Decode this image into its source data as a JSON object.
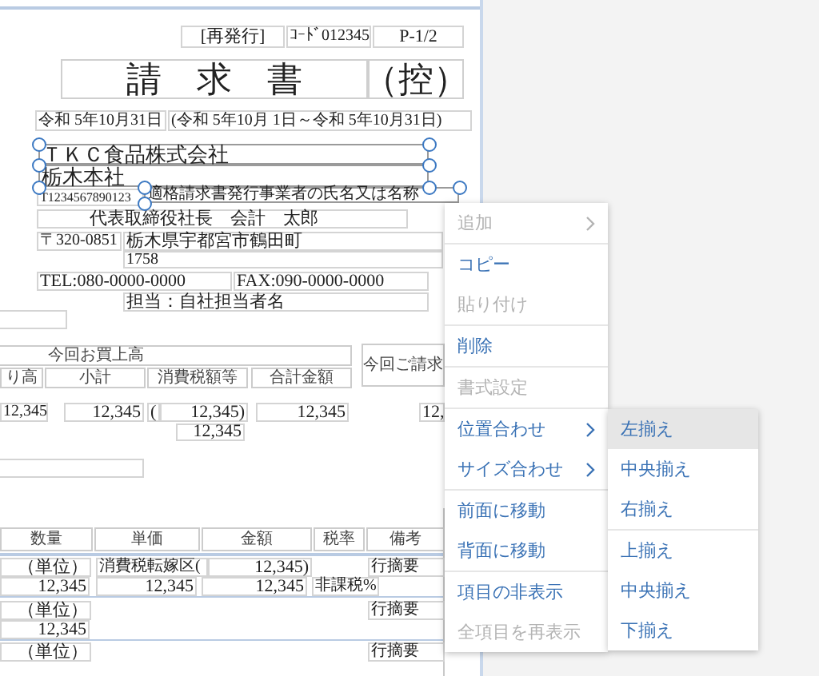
{
  "document": {
    "fields": [
      {
        "kind": "field",
        "text": "[再発行]",
        "selected": false
      },
      {
        "kind": "field",
        "text": "ｺｰﾄﾞ012345",
        "selected": false
      },
      {
        "kind": "field",
        "text": "P-1/2",
        "selected": false
      },
      {
        "kind": "title",
        "text": "請　求　書",
        "selected": false
      },
      {
        "kind": "title",
        "text": "（控）",
        "selected": false
      },
      {
        "kind": "field",
        "text": "令和 5年10月31日",
        "selected": false
      },
      {
        "kind": "field",
        "text": "(令和 5年10月 1日～令和 5年10月31日)",
        "selected": false
      },
      {
        "kind": "field",
        "text": "ＴＫＣ食品株式会社",
        "selected": true
      },
      {
        "kind": "field",
        "text": "栃木本社",
        "selected": true
      },
      {
        "kind": "field",
        "text": "T1234567890123",
        "selected": false
      },
      {
        "kind": "field",
        "text": "適格請求書発行事業者の氏名又は名称",
        "selected": true
      },
      {
        "kind": "field",
        "text": "代表取締役社長　会計　太郎",
        "selected": false
      },
      {
        "kind": "field",
        "text": "〒320-0851",
        "selected": false
      },
      {
        "kind": "field",
        "text": "栃木県宇都宮市鶴田町",
        "selected": false
      },
      {
        "kind": "field",
        "text": "1758",
        "selected": false
      },
      {
        "kind": "field",
        "text": "TEL:080-0000-0000",
        "selected": false
      },
      {
        "kind": "field",
        "text": "FAX:090-0000-0000",
        "selected": false
      },
      {
        "kind": "field",
        "text": "担当：自社担当者名",
        "selected": false
      },
      {
        "kind": "header",
        "text": "今回お買上高",
        "selected": false
      },
      {
        "kind": "header",
        "text": "今回ご請求",
        "selected": false
      },
      {
        "kind": "header",
        "text": "り高",
        "selected": false
      },
      {
        "kind": "header",
        "text": "小計",
        "selected": false
      },
      {
        "kind": "header",
        "text": "消費税額等",
        "selected": false
      },
      {
        "kind": "header",
        "text": "合計金額",
        "selected": false
      },
      {
        "kind": "field",
        "text": "12,345",
        "selected": false
      },
      {
        "kind": "field",
        "text": "12,345",
        "selected": false
      },
      {
        "kind": "field",
        "text": "(",
        "selected": false
      },
      {
        "kind": "field",
        "text": "12,345)",
        "selected": false
      },
      {
        "kind": "field",
        "text": "12,345",
        "selected": false
      },
      {
        "kind": "field",
        "text": "12,",
        "selected": false
      },
      {
        "kind": "field",
        "text": "12,345",
        "selected": false
      },
      {
        "kind": "header",
        "text": "数量",
        "selected": false
      },
      {
        "kind": "header",
        "text": "単価",
        "selected": false
      },
      {
        "kind": "header",
        "text": "金額",
        "selected": false
      },
      {
        "kind": "header",
        "text": "税率",
        "selected": false
      },
      {
        "kind": "header",
        "text": "備考",
        "selected": false
      },
      {
        "kind": "field",
        "text": "（単位）",
        "selected": false
      },
      {
        "kind": "field",
        "text": "消費税転嫁区(",
        "selected": false
      },
      {
        "kind": "field",
        "text": "12,345)",
        "selected": false
      },
      {
        "kind": "field",
        "text": "行摘要",
        "selected": false
      },
      {
        "kind": "field",
        "text": "12,345",
        "selected": false
      },
      {
        "kind": "field",
        "text": "12,345",
        "selected": false
      },
      {
        "kind": "field",
        "text": "12,345",
        "selected": false
      },
      {
        "kind": "field",
        "text": "非課税%",
        "selected": false
      },
      {
        "kind": "field",
        "text": "（単位）",
        "selected": false
      },
      {
        "kind": "field",
        "text": "行摘要",
        "selected": false
      },
      {
        "kind": "field",
        "text": "12,345",
        "selected": false
      },
      {
        "kind": "field",
        "text": "（単位）",
        "selected": false
      },
      {
        "kind": "field",
        "text": "行摘要",
        "selected": false
      }
    ]
  },
  "context_menu": {
    "groups": [
      [
        {
          "label": "追加",
          "disabled": true,
          "submenu": true
        }
      ],
      [
        {
          "label": "コピー",
          "disabled": false,
          "submenu": false
        },
        {
          "label": "貼り付け",
          "disabled": true,
          "submenu": false
        }
      ],
      [
        {
          "label": "削除",
          "disabled": false,
          "submenu": false
        }
      ],
      [
        {
          "label": "書式設定",
          "disabled": true,
          "submenu": false
        }
      ],
      [
        {
          "label": "位置合わせ",
          "disabled": false,
          "submenu": true
        },
        {
          "label": "サイズ合わせ",
          "disabled": false,
          "submenu": true
        }
      ],
      [
        {
          "label": "前面に移動",
          "disabled": false,
          "submenu": false
        },
        {
          "label": "背面に移動",
          "disabled": false,
          "submenu": false
        }
      ],
      [
        {
          "label": "項目の非表示",
          "disabled": false,
          "submenu": false
        },
        {
          "label": "全項目を再表示",
          "disabled": true,
          "submenu": false
        }
      ]
    ]
  },
  "submenu": {
    "groups": [
      [
        {
          "label": "左揃え",
          "selected": true
        },
        {
          "label": "中央揃え",
          "selected": false
        },
        {
          "label": "右揃え",
          "selected": false
        }
      ],
      [
        {
          "label": "上揃え",
          "selected": false
        },
        {
          "label": "中央揃え",
          "selected": false
        },
        {
          "label": "下揃え",
          "selected": false
        }
      ]
    ]
  }
}
